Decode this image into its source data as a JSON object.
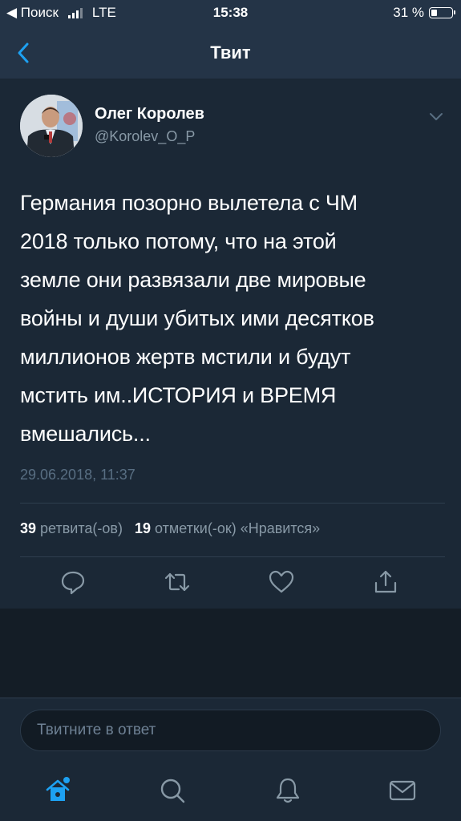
{
  "status_bar": {
    "carrier": "◀ Поиск",
    "network": "LTE",
    "time": "15:38",
    "battery_text": "31 %",
    "battery_level": 0.31
  },
  "nav": {
    "title": "Твит",
    "back_icon": "chevron-left-icon"
  },
  "tweet": {
    "author_name": "Олег Королев",
    "author_handle": "@Korolev_O_P",
    "text": "Германия позорно вылетела с ЧМ\n2018 только потому, что на этой\nземле они развязали две мировые\nвойны и души убитых ими десятков\nмиллионов жертв мстили и будут\nмстить им..ИСТОРИЯ и ВРЕМЯ\nвмешались...",
    "date": "29.06.2018, 11:37",
    "retweets_count": "39",
    "retweets_label": "ретвита(-ов)",
    "likes_count": "19",
    "likes_label": "отметки(-ок) «Нравится»",
    "actions": [
      "reply-icon",
      "retweet-icon",
      "heart-icon",
      "share-icon"
    ]
  },
  "reply": {
    "placeholder": "Твитните в ответ"
  },
  "tabbar": {
    "items": [
      "home-icon",
      "search-icon",
      "notifications-icon",
      "messages-icon"
    ]
  },
  "colors": {
    "background": "#141d26",
    "card": "#1b2836",
    "bar": "#243447",
    "accent": "#1da1f2",
    "muted": "#8899a6"
  }
}
